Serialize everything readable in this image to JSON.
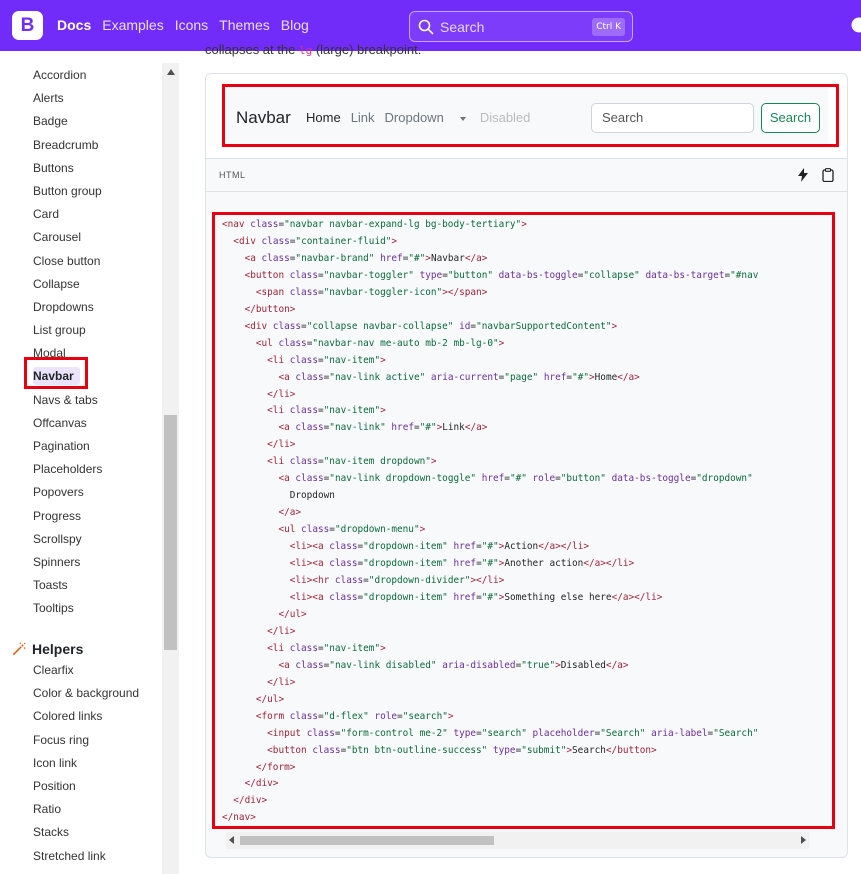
{
  "topbar": {
    "logo_letter": "B",
    "nav": [
      "Docs",
      "Examples",
      "Icons",
      "Themes",
      "Blog"
    ],
    "search_placeholder": "Search",
    "shortcut": "Ctrl K",
    "accent": "#712cf9"
  },
  "sidebar": {
    "components": [
      "Accordion",
      "Alerts",
      "Badge",
      "Breadcrumb",
      "Buttons",
      "Button group",
      "Card",
      "Carousel",
      "Close button",
      "Collapse",
      "Dropdowns",
      "List group",
      "Modal",
      "Navbar",
      "Navs & tabs",
      "Offcanvas",
      "Pagination",
      "Placeholders",
      "Popovers",
      "Progress",
      "Scrollspy",
      "Spinners",
      "Toasts",
      "Tooltips"
    ],
    "active": "Navbar",
    "helpers_title": "Helpers",
    "helpers": [
      "Clearfix",
      "Color & background",
      "Colored links",
      "Focus ring",
      "Icon link",
      "Position",
      "Ratio",
      "Stacks",
      "Stretched link"
    ]
  },
  "content": {
    "intro_prefix": "collapses at the",
    "intro_code": "lg",
    "intro_suffix": "(large) breakpoint.",
    "demo": {
      "brand": "Navbar",
      "links": [
        "Home",
        "Link",
        "Dropdown",
        "Disabled"
      ],
      "search_placeholder": "Search",
      "search_button": "Search"
    },
    "code_lang": "HTML"
  }
}
